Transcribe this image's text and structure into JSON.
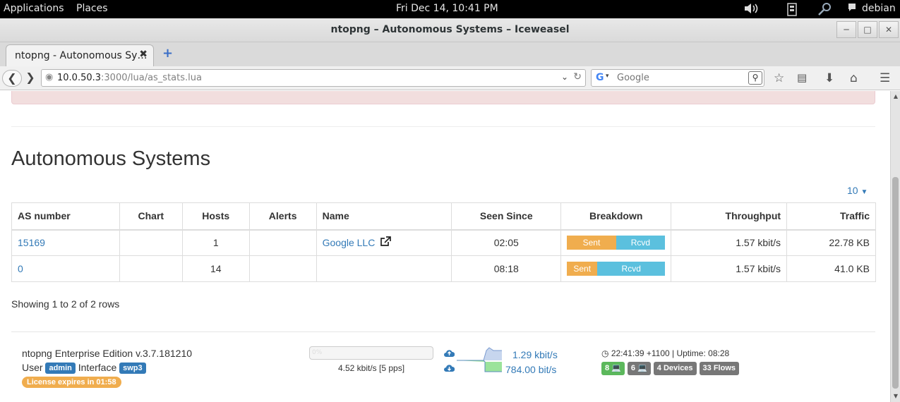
{
  "system": {
    "applications_label": "Applications",
    "places_label": "Places",
    "clock": "Fri Dec 14, 10:41 PM",
    "username": "debian"
  },
  "window": {
    "title": "ntopng – Autonomous Systems – Iceweasel"
  },
  "browser": {
    "tab_title": "ntopng - Autonomous Sy…",
    "url_host": "10.0.50.3",
    "url_path": ":3000/lua/as_stats.lua",
    "search_placeholder": "Google"
  },
  "page": {
    "title": "Autonomous Systems",
    "per_page": "10",
    "columns": {
      "as_number": "AS number",
      "chart": "Chart",
      "hosts": "Hosts",
      "alerts": "Alerts",
      "name": "Name",
      "seen_since": "Seen Since",
      "breakdown": "Breakdown",
      "throughput": "Throughput",
      "traffic": "Traffic"
    },
    "rows": [
      {
        "as_number": "15169",
        "chart": "",
        "hosts": "1",
        "alerts": "",
        "name": "Google LLC",
        "seen_since": "02:05",
        "sent_label": "Sent",
        "rcvd_label": "Rcvd",
        "sent_fraction": 0.5,
        "throughput": "1.57 kbit/s",
        "traffic": "22.78 KB"
      },
      {
        "as_number": "0",
        "chart": "",
        "hosts": "14",
        "alerts": "",
        "name": "",
        "seen_since": "08:18",
        "sent_label": "Sent",
        "rcvd_label": "Rcvd",
        "sent_fraction": 0.31,
        "throughput": "1.57 kbit/s",
        "traffic": "41.0 KB"
      }
    ],
    "showing": "Showing 1 to 2 of 2 rows"
  },
  "footer": {
    "edition": "ntopng Enterprise Edition v.3.7.181210",
    "user_label": "User",
    "user_badge": "admin",
    "interface_label": "Interface",
    "interface_badge": "swp3",
    "license": "License expires in 01:58",
    "bandwidth_pct": "0%",
    "bandwidth_text": "4.52 kbit/s [5 pps]",
    "upload_rate": "1.29 kbit/s",
    "download_rate": "784.00 bit/s",
    "clock_text": "22:41:39 +1100 | Uptime: 08:28",
    "badges": {
      "local_hosts": "8",
      "remote_hosts": "6",
      "devices": "4 Devices",
      "flows": "33 Flows"
    }
  },
  "colors": {
    "link": "#337ab7",
    "sent": "#f0ad4e",
    "rcvd": "#5bc0de",
    "success": "#5cb85c",
    "muted": "#777777"
  }
}
